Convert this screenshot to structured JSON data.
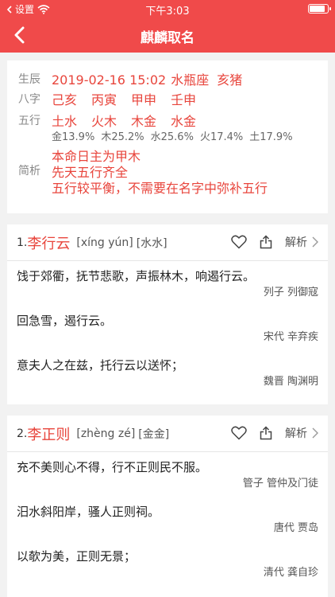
{
  "status": {
    "carrier": "设置",
    "time": "下午3:03",
    "battery_level": 0.9
  },
  "nav": {
    "title": "麒麟取名"
  },
  "info": {
    "shengchen_label": "生辰",
    "shengchen": [
      "2019-02-16 15:02",
      "水瓶座",
      "亥猪"
    ],
    "bazi_label": "八字",
    "bazi": [
      "己亥",
      "丙寅",
      "甲申",
      "壬申"
    ],
    "wuxing_label": "五行",
    "wuxing": [
      "土水",
      "火木",
      "木金",
      "水金"
    ],
    "wuxing_pct": [
      "金13.9%",
      "木25.2%",
      "水25.6%",
      "火17.4%",
      "土17.9%"
    ],
    "jianxi_label": "简析",
    "jianxi": [
      "本命日主为甲木",
      "先天五行齐全",
      "五行较平衡，不需要在名字中弥补五行"
    ]
  },
  "names": [
    {
      "index": "1.",
      "name": "李行云",
      "pinyin": "[xíng yún]",
      "element": "[水水]",
      "explain_label": "解析",
      "poems": [
        {
          "text": "饯于郊衢，抚节悲歌，声振林木，响遏行云。",
          "author": "列子 列御寇"
        },
        {
          "text": "回急雪，遏行云。",
          "author": "宋代 辛弃疾"
        },
        {
          "text": "意夫人之在兹，托行云以送怀；",
          "author": "魏晋 陶渊明"
        }
      ]
    },
    {
      "index": "2.",
      "name": "李正则",
      "pinyin": "[zhèng zé]",
      "element": "[金金]",
      "explain_label": "解析",
      "poems": [
        {
          "text": "充不美则心不得，行不正则民不服。",
          "author": "管子 管仲及门徒"
        },
        {
          "text": "汨水斜阳岸，骚人正则祠。",
          "author": "唐代 贾岛"
        },
        {
          "text": "以欹为美，正则无景；",
          "author": "清代 龚自珍"
        }
      ]
    }
  ]
}
